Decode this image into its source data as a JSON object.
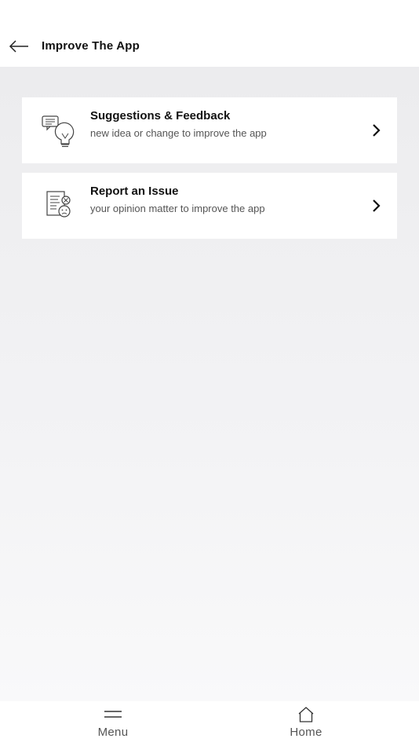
{
  "header": {
    "title": "Improve The App",
    "back_icon": "arrow-left-icon"
  },
  "items": [
    {
      "icon": "lightbulb-chat-icon",
      "title": "Suggestions & Feedback",
      "subtitle": "new idea or change to improve the app",
      "chevron_icon": "chevron-right-icon"
    },
    {
      "icon": "report-document-icon",
      "title": "Report an Issue",
      "subtitle": "your opinion matter to improve the app",
      "chevron_icon": "chevron-right-icon"
    }
  ],
  "bottom_nav": {
    "menu_label": "Menu",
    "menu_icon": "hamburger-menu-icon",
    "home_label": "Home",
    "home_icon": "home-icon"
  },
  "colors": {
    "background_gray": "#ececee",
    "card": "#ffffff",
    "text_primary": "#111111",
    "text_secondary": "#555555"
  }
}
